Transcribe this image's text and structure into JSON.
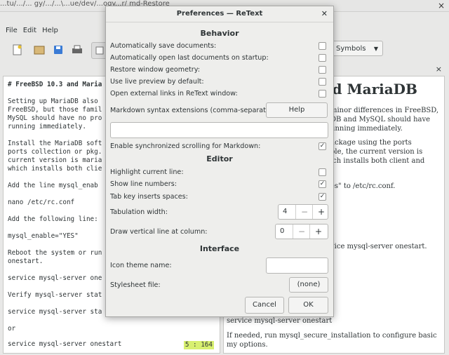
{
  "window": {
    "title_fragment": "...tu/.../... gy/.../...\\...ue/dev/...ogy...r/ md-Restore",
    "close_icon": "×"
  },
  "menu": [
    "File",
    "Edit",
    "Help"
  ],
  "toolbar": {
    "symbols_label": "Symbols"
  },
  "editor": {
    "lines": [
      "# FreeBSD 10.3 and Maria",
      "Setting up MariaDB also\nFreeBSD, but those famil\nMySQL should have no pro\nrunning immediately.",
      "Install the MariaDB soft\nports collection or pkg.\ncurrent version is maria\nwhich installs both clie",
      "Add the line mysql_enab",
      "nano /etc/rc.conf",
      "Add the following line:",
      "mysql_enable=\"YES\"",
      "Reboot the system or run\nonestart.",
      "service mysql-server one",
      "Verify mysql-server stat",
      "service mysql-server sta",
      "or"
    ],
    "last_line": "service mysql-server onestart",
    "cursor_pos": "5 : 164"
  },
  "preview": {
    "heading": "nd MariaDB",
    "p1": "minor differences in FreeBSD,\nDB and MySQL should have\nunning immediately.",
    "p2": "ackage using the ports\nple, the current version is\nich installs both client and",
    "p3": "es\" to /etc/rc.conf.",
    "p4": "vice mysql-server onestart.",
    "p5": "service mysql-server onestart",
    "p6": "If needed, run mysql_secure_installation to configure basic my options."
  },
  "dialog": {
    "title": "Preferences — ReText",
    "behavior": {
      "header": "Behavior",
      "items": [
        {
          "label": "Automatically save documents:",
          "checked": false
        },
        {
          "label": "Automatically open last documents on startup:",
          "checked": false
        },
        {
          "label": "Restore window geometry:",
          "checked": false
        },
        {
          "label": "Use live preview by default:",
          "checked": false
        },
        {
          "label": "Open external links in ReText window:",
          "checked": false
        }
      ],
      "md_ext_label": "Markdown syntax extensions (comma-separated):",
      "help_label": "Help",
      "md_ext_value": "",
      "sync_scroll_label": "Enable synchronized scrolling for Markdown:",
      "sync_scroll_checked": true
    },
    "editor": {
      "header": "Editor",
      "items": [
        {
          "label": "Highlight current line:",
          "checked": false
        },
        {
          "label": "Show line numbers:",
          "checked": true
        },
        {
          "label": "Tab key inserts spaces:",
          "checked": true
        }
      ],
      "tab_width_label": "Tabulation width:",
      "tab_width_value": "4",
      "vline_label": "Draw vertical line at column:",
      "vline_value": "0"
    },
    "interface": {
      "header": "Interface",
      "icon_theme_label": "Icon theme name:",
      "icon_theme_value": "",
      "stylesheet_label": "Stylesheet file:",
      "stylesheet_value": "(none)"
    },
    "cancel_label": "Cancel",
    "ok_label": "OK"
  }
}
